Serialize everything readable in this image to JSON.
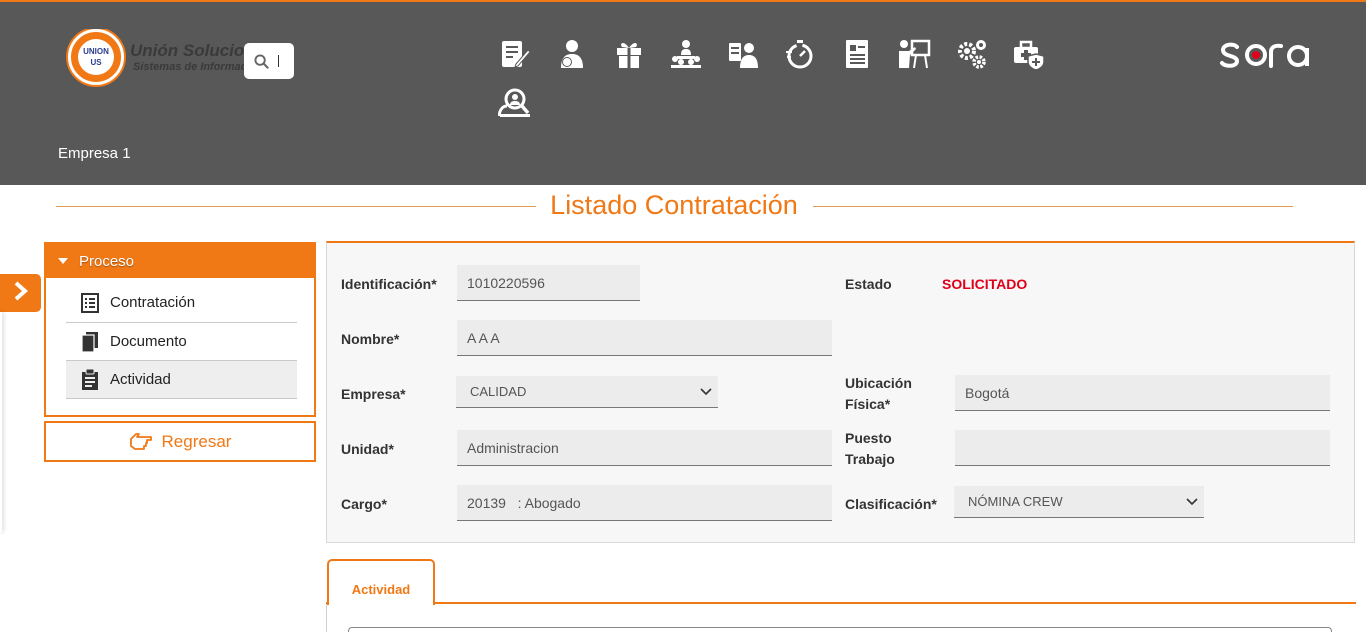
{
  "header": {
    "logo": {
      "badge_text": "UNION US",
      "title": "Unión Soluciones",
      "subtitle": "Sistemas de Información"
    },
    "company": "Empresa 1",
    "brand": "sora",
    "nav_icons": [
      "form-edit-icon",
      "user-money-icon",
      "gift-icon",
      "meeting-icon",
      "user-card-icon",
      "stopwatch-icon",
      "document-list-icon",
      "teacher-board-icon",
      "gears-icon",
      "medical-kit-icon",
      "user-search-icon"
    ]
  },
  "page": {
    "title": "Listado Contratación"
  },
  "process": {
    "header": "Proceso",
    "items": [
      {
        "label": "Contratación",
        "icon": "list-icon"
      },
      {
        "label": "Documento",
        "icon": "documents-icon"
      },
      {
        "label": "Actividad",
        "icon": "clipboard-icon"
      }
    ],
    "back_label": "Regresar"
  },
  "form": {
    "identificacion": {
      "label": "Identificación*",
      "value": "1010220596"
    },
    "estado": {
      "label": "Estado",
      "value": "SOLICITADO"
    },
    "nombre": {
      "label": "Nombre*",
      "value": "A A A"
    },
    "empresa": {
      "label": "Empresa*",
      "value": "CALIDAD"
    },
    "ubicacion": {
      "label1": "Ubicación",
      "label2": "Física*",
      "value": "Bogotá"
    },
    "unidad": {
      "label": "Unidad*",
      "value": "Administracion"
    },
    "puesto": {
      "label1": "Puesto",
      "label2": "Trabajo",
      "value": ""
    },
    "cargo": {
      "label": "Cargo*",
      "value": "20139   : Abogado"
    },
    "clasificacion": {
      "label": "Clasificación*",
      "value": "NÓMINA CREW"
    }
  },
  "tabs": [
    {
      "label": "Actividad"
    }
  ],
  "colors": {
    "accent": "#f07815",
    "header_bg": "#585858",
    "status": "#e0001b"
  }
}
